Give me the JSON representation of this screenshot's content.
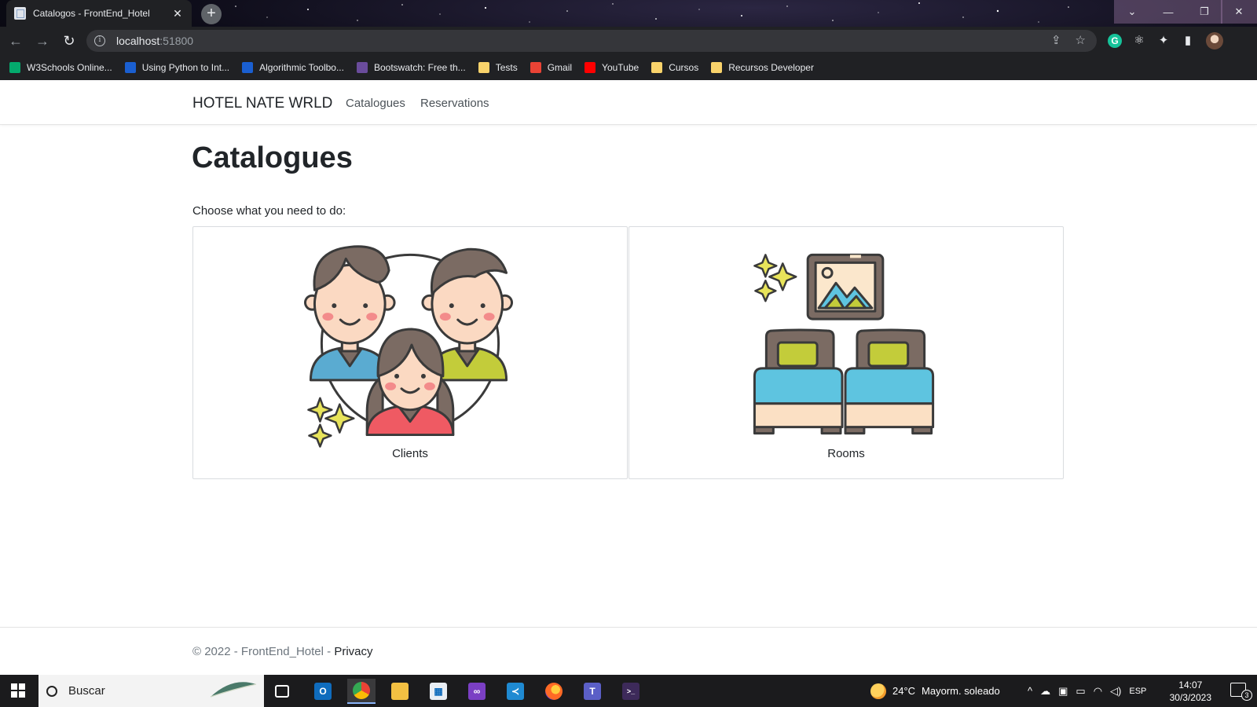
{
  "browser": {
    "tab_title": "Catalogos - FrontEnd_Hotel",
    "tab_close": "✕",
    "new_tab": "+",
    "url_host": "localhost",
    "url_port": ":51800",
    "bookmarks": [
      {
        "label": "W3Schools Online...",
        "icon": "w3schools-icon",
        "color": "#04aa6d"
      },
      {
        "label": "Using Python to Int...",
        "icon": "coursera-icon",
        "color": "#1a5fd1"
      },
      {
        "label": "Algorithmic Toolbo...",
        "icon": "coursera-icon",
        "color": "#1a5fd1"
      },
      {
        "label": "Bootswatch: Free th...",
        "icon": "bootswatch-icon",
        "color": "#6a4c9c"
      },
      {
        "label": "Tests",
        "icon": "folder-icon",
        "color": "#f9d36b"
      },
      {
        "label": "Gmail",
        "icon": "gmail-icon",
        "color": "#ea4335"
      },
      {
        "label": "YouTube",
        "icon": "youtube-icon",
        "color": "#ff0000"
      },
      {
        "label": "Cursos",
        "icon": "folder-icon",
        "color": "#f9d36b"
      },
      {
        "label": "Recursos Developer",
        "icon": "folder-icon",
        "color": "#f9d36b"
      }
    ]
  },
  "site": {
    "brand": "HOTEL NATE WRLD",
    "nav": [
      "Catalogues",
      "Reservations"
    ],
    "page_title": "Catalogues",
    "prompt": "Choose what you need to do:",
    "cards": [
      {
        "label": "Clients",
        "image": "clients-illustration"
      },
      {
        "label": "Rooms",
        "image": "rooms-illustration"
      }
    ],
    "footer_text": "© 2022 - FrontEnd_Hotel - ",
    "footer_link": "Privacy"
  },
  "taskbar": {
    "search_placeholder": "Buscar",
    "weather_temp": "24°C",
    "weather_desc": "Mayorm. soleado",
    "language": "ESP",
    "time": "14:07",
    "date": "30/3/2023",
    "notification_count": "3"
  },
  "colors": {
    "accent_nav": "#212529",
    "card_border": "#d9dcdf",
    "taskbar_bg": "#1b1b1d"
  }
}
